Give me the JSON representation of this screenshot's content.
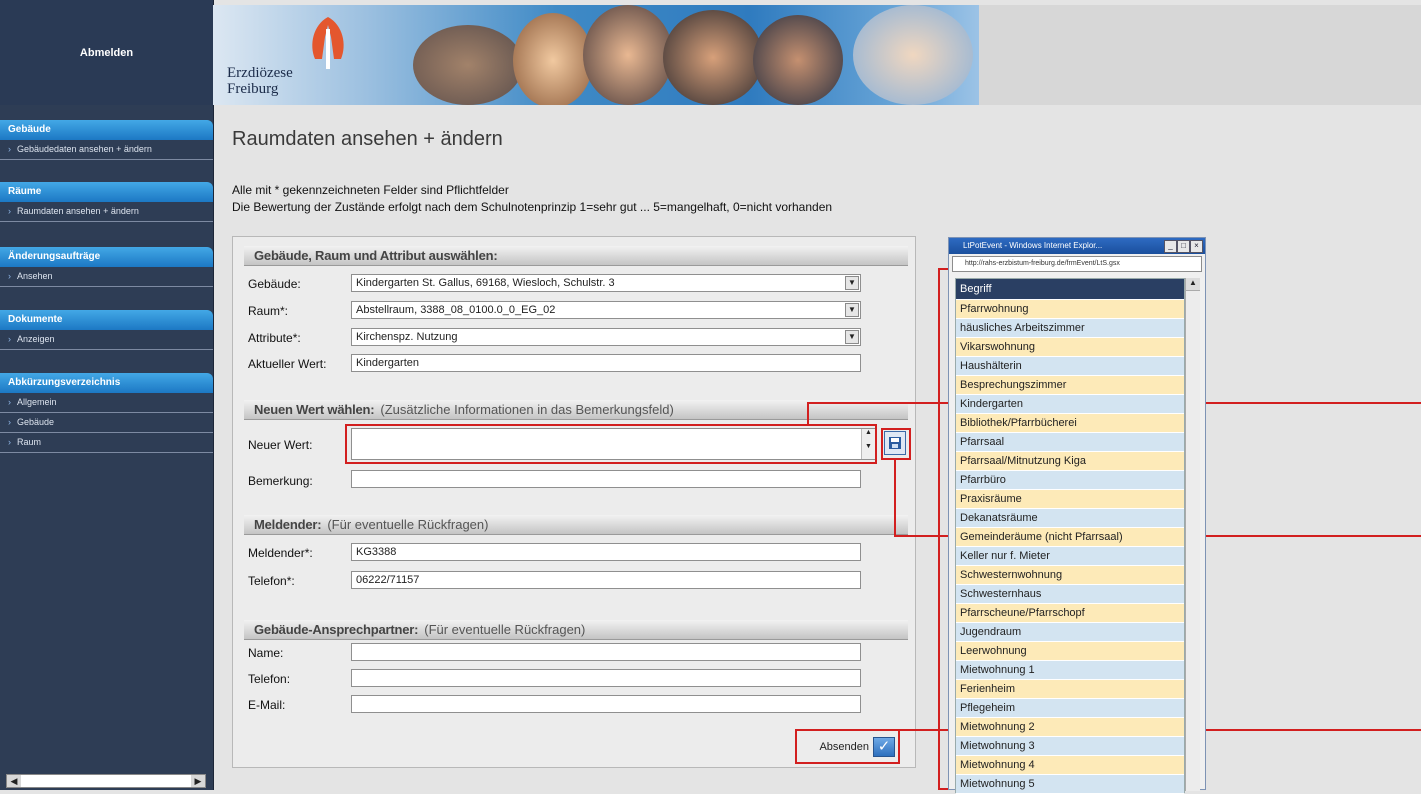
{
  "sidebar": {
    "logout": "Abmelden",
    "sections": [
      {
        "title": "Gebäude",
        "items": [
          "Gebäudedaten ansehen + ändern"
        ]
      },
      {
        "title": "Räume",
        "items": [
          "Raumdaten ansehen + ändern"
        ]
      },
      {
        "title": "Änderungsaufträge",
        "items": [
          "Ansehen"
        ]
      },
      {
        "title": "Dokumente",
        "items": [
          "Anzeigen"
        ]
      },
      {
        "title": "Abkürzungsverzeichnis",
        "items": [
          "Allgemein",
          "Gebäude",
          "Raum"
        ]
      }
    ]
  },
  "banner": {
    "org_line1": "Erzdiözese",
    "org_line2": "Freiburg"
  },
  "page": {
    "title": "Raumdaten ansehen + ändern",
    "intro_line1": "Alle mit * gekennzeichneten Felder sind Pflichtfelder",
    "intro_line2": "Die Bewertung der Zustände erfolgt nach dem Schulnotenprinzip 1=sehr gut ... 5=mangelhaft, 0=nicht vorhanden"
  },
  "form": {
    "section1": {
      "title": "Gebäude, Raum und Attribut auswählen:"
    },
    "gebaeude": {
      "label": "Gebäude:",
      "value": "Kindergarten St. Gallus, 69168, Wiesloch, Schulstr. 3"
    },
    "raum": {
      "label": "Raum*:",
      "value": "Abstellraum, 3388_08_0100.0_0_EG_02"
    },
    "attribute": {
      "label": "Attribute*:",
      "value": "Kirchenspz. Nutzung"
    },
    "aktueller_wert": {
      "label": "Aktueller Wert:",
      "value": "Kindergarten"
    },
    "section2": {
      "title": "Neuen Wert wählen:",
      "subtitle": "(Zusätzliche Informationen in das Bemerkungsfeld)"
    },
    "neuer_wert": {
      "label": "Neuer Wert:",
      "value": ""
    },
    "bemerkung": {
      "label": "Bemerkung:",
      "value": ""
    },
    "section3": {
      "title": "Meldender:",
      "subtitle": "(Für eventuelle Rückfragen)"
    },
    "meldender": {
      "label": "Meldender*:",
      "value": "KG3388"
    },
    "telefon": {
      "label": "Telefon*:",
      "value": "06222/71157"
    },
    "section4": {
      "title": "Gebäude-Ansprechpartner:",
      "subtitle": "(Für eventuelle Rückfragen)"
    },
    "ap_name": {
      "label": "Name:",
      "value": ""
    },
    "ap_telefon": {
      "label": "Telefon:",
      "value": ""
    },
    "ap_email": {
      "label": "E-Mail:",
      "value": ""
    },
    "submit_label": "Absenden"
  },
  "popup": {
    "title": "LtPotEvent - Windows Internet Explor...",
    "address": "http://rahs-erzbistum-freiburg.de/frmEvent/LtS.gsx",
    "list_header": "Begriff",
    "items": [
      "Pfarrwohnung",
      "häusliches Arbeitszimmer",
      "Vikarswohnung",
      "Haushälterin",
      "Besprechungszimmer",
      "Kindergarten",
      "Bibliothek/Pfarrbücherei",
      "Pfarrsaal",
      "Pfarrsaal/Mitnutzung Kiga",
      "Pfarrbüro",
      "Praxisräume",
      "Dekanatsräume",
      "Gemeinderäume (nicht Pfarrsaal)",
      "Keller nur f. Mieter",
      "Schwesternwohnung",
      "Schwesternhaus",
      "Pfarrscheune/Pfarrschopf",
      "Jugendraum",
      "Leerwohnung",
      "Mietwohnung 1",
      "Ferienheim",
      "Pflegeheim",
      "Mietwohnung 2",
      "Mietwohnung 3",
      "Mietwohnung 4",
      "Mietwohnung 5"
    ]
  }
}
